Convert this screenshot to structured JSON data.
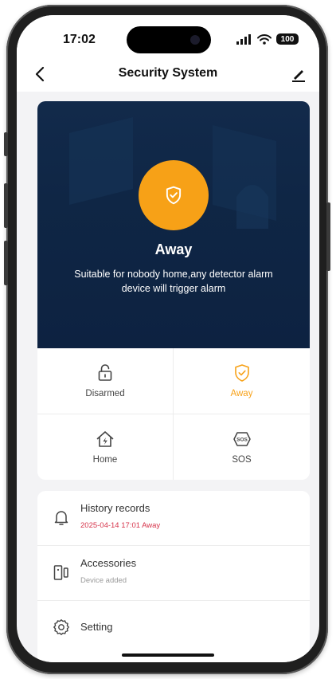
{
  "status_bar": {
    "time": "17:02",
    "battery": "100",
    "icons": [
      "signal-icon",
      "wifi-icon",
      "battery-icon"
    ]
  },
  "nav": {
    "title": "Security System",
    "back_icon": "chevron-left-icon",
    "edit_icon": "pencil-icon"
  },
  "hero": {
    "mode_name": "Away",
    "description": "Suitable for nobody home,any detector alarm device will trigger alarm",
    "icon": "shield-check-icon",
    "accent_color": "#f7a117",
    "background_color": "#0f2645"
  },
  "modes": [
    {
      "label": "Disarmed",
      "icon": "unlock-icon",
      "active": false
    },
    {
      "label": "Away",
      "icon": "shield-check-icon",
      "active": true
    },
    {
      "label": "Home",
      "icon": "home-bolt-icon",
      "active": false
    },
    {
      "label": "SOS",
      "icon": "sos-icon",
      "active": false
    }
  ],
  "list": {
    "history": {
      "title": "History records",
      "subtitle": "2025-04-14 17:01 Away",
      "icon": "bell-icon"
    },
    "accessories": {
      "title": "Accessories",
      "subtitle": "Device added",
      "icon": "door-sensor-icon"
    },
    "setting": {
      "title": "Setting",
      "icon": "gear-icon"
    }
  },
  "colors": {
    "alert": "#d6334a",
    "muted": "#9a9a9a"
  }
}
